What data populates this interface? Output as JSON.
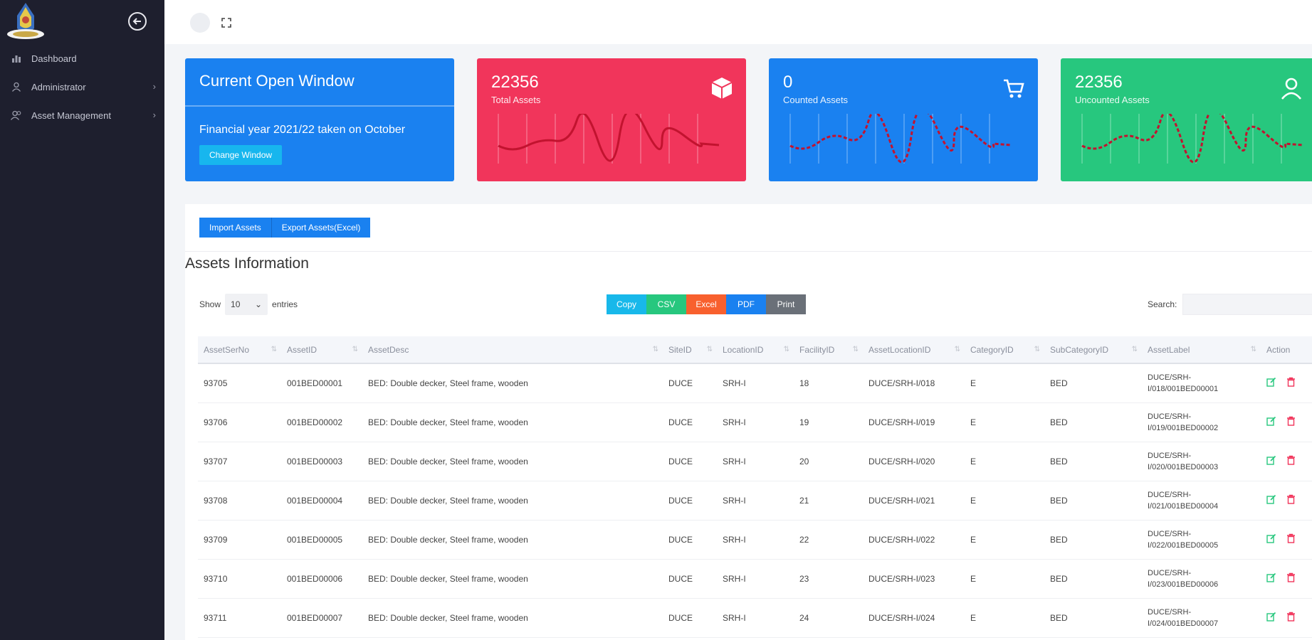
{
  "sidebar": {
    "items": [
      {
        "label": "Dashboard",
        "icon": "chart-icon"
      },
      {
        "label": "Administrator",
        "icon": "user-icon"
      },
      {
        "label": "Asset Management",
        "icon": "users-icon"
      }
    ]
  },
  "cards": {
    "window": {
      "title": "Current Open Window",
      "text": "Financial year 2021/22 taken on October",
      "button": "Change Window"
    },
    "total": {
      "value": "22356",
      "label": "Total Assets",
      "icon": "cube-icon",
      "color": "#f1355b"
    },
    "counted": {
      "value": "0",
      "label": "Counted Assets",
      "icon": "cart-icon",
      "color": "#1a81f0"
    },
    "uncounted": {
      "value": "22356",
      "label": "Uncounted Assets",
      "icon": "user-icon",
      "color": "#27c77e"
    }
  },
  "actions": {
    "import": "Import Assets",
    "export": "Export Assets(Excel)"
  },
  "section_title": "Assets Information",
  "table_controls": {
    "show_label": "Show",
    "show_value": "10",
    "entries_label": "entries",
    "search_label": "Search:",
    "export_buttons": [
      "Copy",
      "CSV",
      "Excel",
      "PDF",
      "Print"
    ]
  },
  "table": {
    "headers": [
      "AssetSerNo",
      "AssetID",
      "AssetDesc",
      "SiteID",
      "LocationID",
      "FacilityID",
      "AssetLocationID",
      "CategoryID",
      "SubCategoryID",
      "AssetLabel",
      "Action"
    ],
    "rows": [
      [
        "93705",
        "001BED00001",
        "BED: Double decker, Steel frame, wooden",
        "DUCE",
        "SRH-I",
        "18",
        "DUCE/SRH-I/018",
        "E",
        "BED",
        "DUCE/SRH-I/018/001BED00001"
      ],
      [
        "93706",
        "001BED00002",
        "BED: Double decker, Steel frame, wooden",
        "DUCE",
        "SRH-I",
        "19",
        "DUCE/SRH-I/019",
        "E",
        "BED",
        "DUCE/SRH-I/019/001BED00002"
      ],
      [
        "93707",
        "001BED00003",
        "BED: Double decker, Steel frame, wooden",
        "DUCE",
        "SRH-I",
        "20",
        "DUCE/SRH-I/020",
        "E",
        "BED",
        "DUCE/SRH-I/020/001BED00003"
      ],
      [
        "93708",
        "001BED00004",
        "BED: Double decker, Steel frame, wooden",
        "DUCE",
        "SRH-I",
        "21",
        "DUCE/SRH-I/021",
        "E",
        "BED",
        "DUCE/SRH-I/021/001BED00004"
      ],
      [
        "93709",
        "001BED00005",
        "BED: Double decker, Steel frame, wooden",
        "DUCE",
        "SRH-I",
        "22",
        "DUCE/SRH-I/022",
        "E",
        "BED",
        "DUCE/SRH-I/022/001BED00005"
      ],
      [
        "93710",
        "001BED00006",
        "BED: Double decker, Steel frame, wooden",
        "DUCE",
        "SRH-I",
        "23",
        "DUCE/SRH-I/023",
        "E",
        "BED",
        "DUCE/SRH-I/023/001BED00006"
      ],
      [
        "93711",
        "001BED00007",
        "BED: Double decker, Steel frame, wooden",
        "DUCE",
        "SRH-I",
        "24",
        "DUCE/SRH-I/024",
        "E",
        "BED",
        "DUCE/SRH-I/024/001BED00007"
      ]
    ]
  }
}
